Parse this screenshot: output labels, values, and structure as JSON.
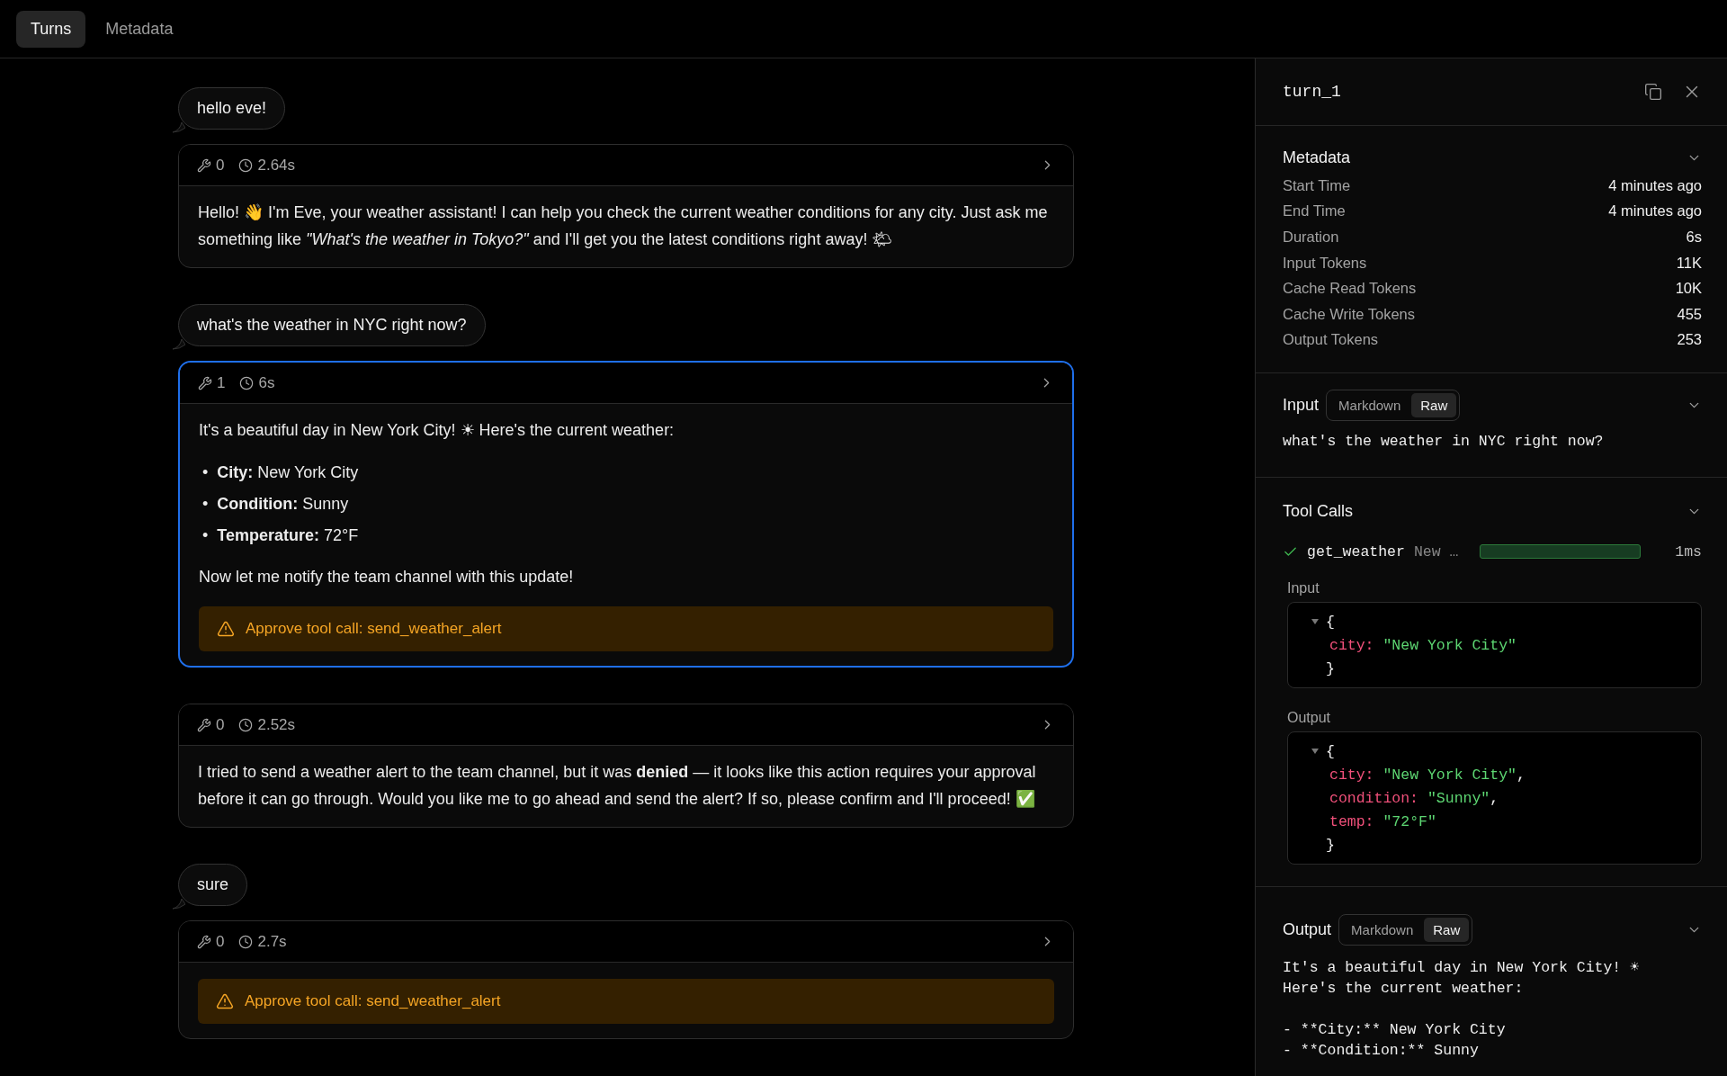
{
  "tabs": [
    {
      "label": "Turns",
      "selected": true
    },
    {
      "label": "Metadata",
      "selected": false
    }
  ],
  "turns": [
    {
      "kind": "user",
      "text": "hello eve!"
    },
    {
      "kind": "assistant",
      "selected": false,
      "tools": "0",
      "duration": "2.64s",
      "blocks": [
        {
          "kind": "paragraph",
          "text": "Hello! 👋 I'm Eve, your weather assistant! I can help you check the current weather conditions for any city. Just ask me something like *\"What's the weather in Tokyo?\"* and I'll get you the latest conditions right away! 🌤"
        }
      ]
    },
    {
      "kind": "user",
      "text": "what's the weather in NYC right now?"
    },
    {
      "kind": "assistant",
      "selected": true,
      "tools": "1",
      "duration": "6s",
      "blocks": [
        {
          "kind": "paragraph",
          "text": "It's a beautiful day in New York City! ☀ Here's the current weather:"
        },
        {
          "kind": "list",
          "items": [
            {
              "bullet": "•",
              "text": "**City:** New York City"
            },
            {
              "bullet": "•",
              "text": "**Condition:** Sunny"
            },
            {
              "bullet": "•",
              "text": "**Temperature:** 72°F"
            }
          ]
        },
        {
          "kind": "paragraph",
          "text": "Now let me notify the team channel with this update!"
        },
        {
          "kind": "approval",
          "text": "Approve tool call: send_weather_alert"
        }
      ]
    },
    {
      "kind": "assistant",
      "selected": false,
      "tools": "0",
      "duration": "2.52s",
      "blocks": [
        {
          "kind": "paragraph",
          "text": "I tried to send a weather alert to the team channel, but it was **denied** — it looks like this action requires your approval before it can go through. Would you like me to go ahead and send the alert? If so, please confirm and I'll proceed! ✅"
        }
      ]
    },
    {
      "kind": "user",
      "text": "sure"
    },
    {
      "kind": "assistant",
      "selected": false,
      "tools": "0",
      "duration": "2.7s",
      "blocks": [
        {
          "kind": "approval",
          "text": "Approve tool call: send_weather_alert"
        }
      ]
    }
  ],
  "panel": {
    "title": "turn_1",
    "metadata": {
      "title": "Metadata",
      "rows": [
        {
          "label": "Start Time",
          "value": "4 minutes ago"
        },
        {
          "label": "End Time",
          "value": "4 minutes ago"
        },
        {
          "label": "Duration",
          "value": "6s"
        },
        {
          "label": "Input Tokens",
          "value": "11K"
        },
        {
          "label": "Cache Read Tokens",
          "value": "10K"
        },
        {
          "label": "Cache Write Tokens",
          "value": "455"
        },
        {
          "label": "Output Tokens",
          "value": "253"
        }
      ]
    },
    "input": {
      "title": "Input",
      "modes": [
        {
          "label": "Markdown",
          "selected": false
        },
        {
          "label": "Raw",
          "selected": true
        }
      ],
      "text": "what's the weather in NYC right now?"
    },
    "tool_calls": {
      "title": "Tool Calls",
      "calls": [
        {
          "name": "get_weather",
          "args": "New …",
          "time": "1ms",
          "succeeded": true,
          "input": {
            "label": "Input",
            "open": "{",
            "close": "}",
            "fields": [
              {
                "key": "city:",
                "value": "\"New York City\""
              }
            ]
          },
          "output": {
            "label": "Output",
            "open": "{",
            "close": "}",
            "fields": [
              {
                "key": "city:",
                "value": "\"New York City\"",
                "suffix": ","
              },
              {
                "key": "condition:",
                "value": "\"Sunny\"",
                "suffix": ","
              },
              {
                "key": "temp:",
                "value": "\"72°F\""
              }
            ]
          }
        }
      ]
    },
    "output": {
      "title": "Output",
      "modes": [
        {
          "label": "Markdown",
          "selected": false
        },
        {
          "label": "Raw",
          "selected": true
        }
      ],
      "paragraphs": [
        [
          "It's a beautiful day in New York City! ☀",
          "Here's the current weather:"
        ],
        [
          "- **City:** New York City",
          "- **Condition:** Sunny"
        ]
      ]
    }
  }
}
